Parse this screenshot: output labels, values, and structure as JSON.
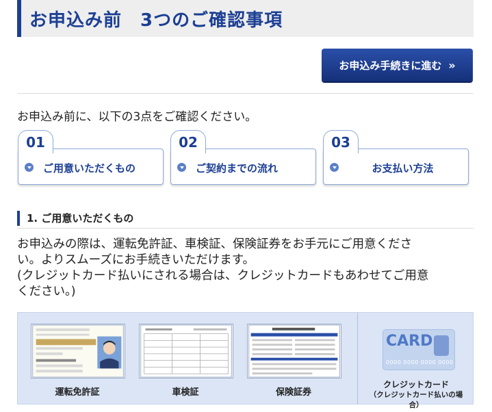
{
  "header": {
    "title": "お申込み前　3つのご確認事項"
  },
  "cta": {
    "label": "お申込み手続きに進む",
    "chevron": "»"
  },
  "intro_text": "お申込み前に、以下の3点をご確認ください。",
  "steps": [
    {
      "number": "01",
      "label": "ご用意いただくもの",
      "icon": "circle-chevron-down-icon"
    },
    {
      "number": "02",
      "label": "ご契約までの流れ",
      "icon": "circle-chevron-down-icon"
    },
    {
      "number": "03",
      "label": "お支払い方法",
      "icon": "circle-chevron-down-icon"
    }
  ],
  "section1": {
    "heading": "1. ご用意いただくもの",
    "body_line1": "お申込みの際は、運転免許証、車検証、保険証券をお手元にご用意くださ",
    "body_line2": "い。よりスムーズにお手続きいただけます。",
    "body_line3": "(クレジットカード払いにされる場合は、クレジットカードもあわせてご用意",
    "body_line4": "ください。)"
  },
  "documents": [
    {
      "caption": "運転免許証",
      "icon": "drivers-license-icon"
    },
    {
      "caption": "車検証",
      "icon": "vehicle-inspection-certificate-icon"
    },
    {
      "caption": "保険証券",
      "icon": "insurance-policy-icon"
    }
  ],
  "credit_card": {
    "caption_line1": "クレジットカード",
    "caption_line2": "（クレジットカード払いの場合）",
    "card_word": "CARD",
    "card_number": "0000 0000 0000 0000",
    "icon": "credit-card-icon"
  },
  "colors": {
    "brand": "#1c3f94",
    "panel": "#dbe5f6",
    "header_bg": "#eeeeee"
  }
}
